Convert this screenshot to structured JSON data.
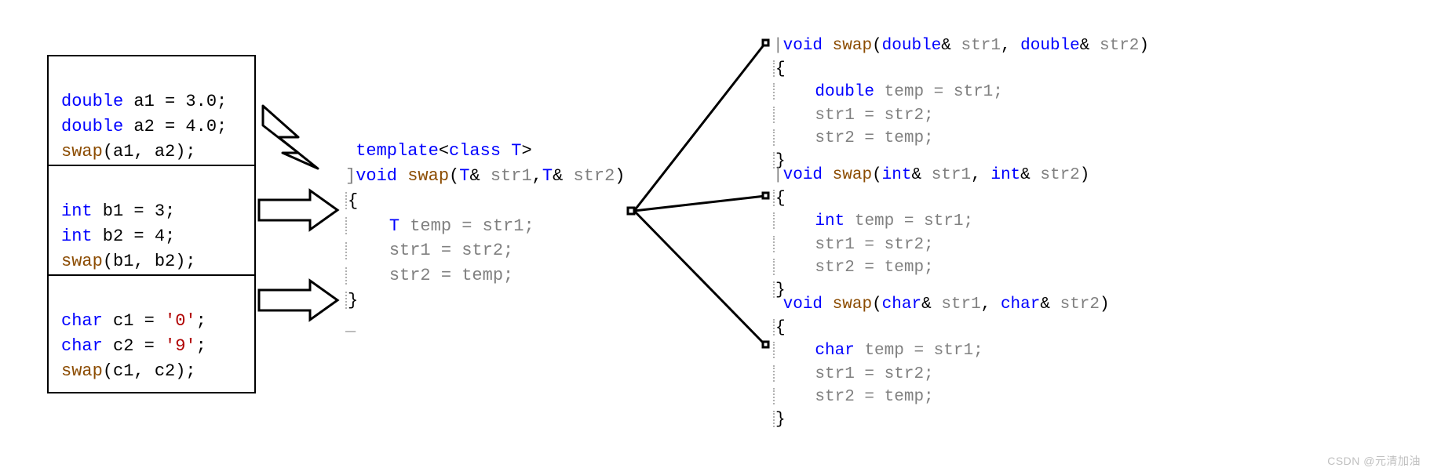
{
  "colors": {
    "keyword": "#0000ff",
    "identifier_dim": "#808080",
    "func": "#8b4b00",
    "literal_char": "#b00000"
  },
  "left_boxes": {
    "box1": {
      "l1_kw": "double",
      "l1_rest": " a1 = 3.0;",
      "l2_kw": "double",
      "l2_rest": " a2 = 4.0;",
      "l3_fn": "swap",
      "l3_rest": "(a1, a2);"
    },
    "box2": {
      "l1_kw": "int",
      "l1_rest": " b1 = 3;",
      "l2_kw": "int",
      "l2_rest": " b2 = 4;",
      "l3_fn": "swap",
      "l3_rest": "(b1, b2);"
    },
    "box3": {
      "l1_kw": "char",
      "l1_rest_a": " c1 = ",
      "l1_lit": "'0'",
      "l1_rest_b": ";",
      "l2_kw": "char",
      "l2_rest_a": " c2 = ",
      "l2_lit": "'9'",
      "l2_rest_b": ";",
      "l3_fn": "swap",
      "l3_rest": "(c1, c2);"
    }
  },
  "center": {
    "l1_tmpl": "template",
    "l1_lt": "<",
    "l1_class": "class",
    "l1_T": " T",
    "l1_gt": ">",
    "l2_void": "void",
    "l2_swap": "swap",
    "l2_open": "(",
    "l2_T1": "T",
    "l2_amp1": "& ",
    "l2_s1": "str1",
    "l2_comma": ",",
    "l2_T2": "T",
    "l2_amp2": "& ",
    "l2_s2": "str2",
    "l2_close": ")",
    "l3": "{",
    "l4_T": "T",
    "l4_rest": " temp = str1;",
    "l5": "str1 = str2;",
    "l6": "str2 = temp;",
    "l7": "}",
    "end_marker": "_"
  },
  "right": {
    "g1": {
      "sig_void": "void",
      "sig_swap": "swap",
      "open": "(",
      "t1": "double",
      "amp1": "& ",
      "p1": "str1",
      "comma": ", ",
      "t2": "double",
      "amp2": "& ",
      "p2": "str2",
      "close": ")",
      "lb": "{",
      "body_t": "double",
      "body_rest": " temp = str1;",
      "assign1": "str1 = str2;",
      "assign2": "str2 = temp;",
      "rb": "}"
    },
    "g2": {
      "sig_void": "void",
      "sig_swap": "swap",
      "open": "(",
      "t1": "int",
      "amp1": "& ",
      "p1": "str1",
      "comma": ", ",
      "t2": "int",
      "amp2": "& ",
      "p2": "str2",
      "close": ")",
      "lb": "{",
      "body_t": "int",
      "body_rest": " temp = str1;",
      "assign1": "str1 = str2;",
      "assign2": "str2 = temp;",
      "rb": "}"
    },
    "g3": {
      "sig_void": "void",
      "sig_swap": "swap",
      "open": "(",
      "t1": "char",
      "amp1": "& ",
      "p1": "str1",
      "comma": ", ",
      "t2": "char",
      "amp2": "& ",
      "p2": "str2",
      "close": ")",
      "lb": "{",
      "body_t": "char",
      "body_rest": " temp = str1;",
      "assign1": "str1 = str2;",
      "assign2": "str2 = temp;",
      "rb": "}"
    }
  },
  "watermark": "CSDN @元清加油"
}
